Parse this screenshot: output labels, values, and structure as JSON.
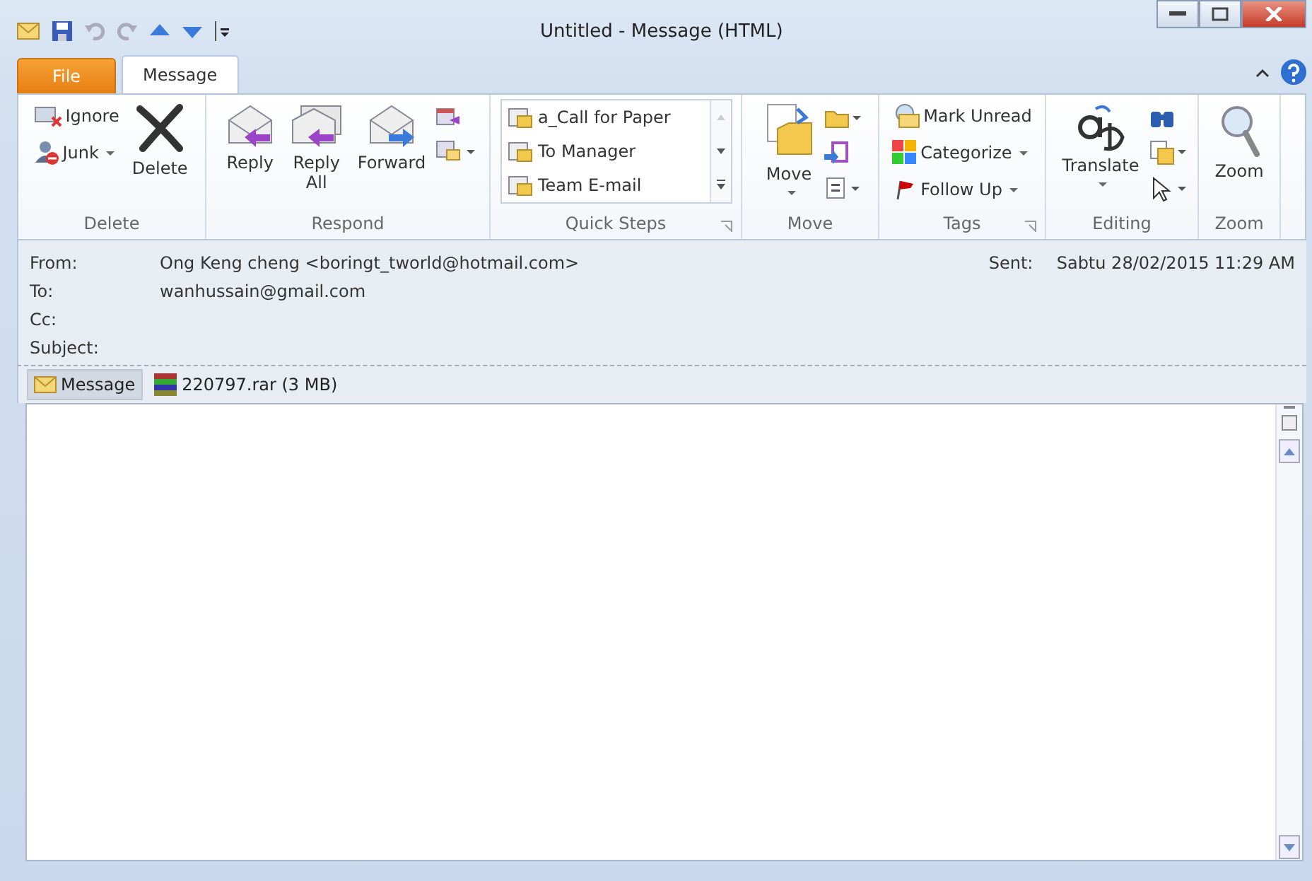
{
  "window": {
    "title": "Untitled  -  Message (HTML)"
  },
  "tabs": [
    {
      "label": "File",
      "kind": "file",
      "selected": false
    },
    {
      "label": "Message",
      "kind": "tab",
      "selected": true
    }
  ],
  "ribbon": {
    "delete": {
      "label": "Delete",
      "ignore": "Ignore",
      "junk": "Junk",
      "delete": "Delete"
    },
    "respond": {
      "label": "Respond",
      "reply": "Reply",
      "reply_all": [
        "Reply",
        "All"
      ],
      "forward": "Forward"
    },
    "quick_steps": {
      "label": "Quick Steps",
      "items": [
        "a_Call for Paper",
        "To Manager",
        "Team E-mail"
      ]
    },
    "move": {
      "label": "Move",
      "move": "Move"
    },
    "tags": {
      "label": "Tags",
      "items": [
        "Mark Unread",
        "Categorize",
        "Follow Up"
      ]
    },
    "editing": {
      "label": "Editing",
      "translate": "Translate"
    },
    "zoom": {
      "label": "Zoom",
      "zoom": "Zoom"
    }
  },
  "header": {
    "fields": [
      {
        "label": "From:",
        "value": "Ong Keng cheng <boringt_tworld@hotmail.com>"
      },
      {
        "label": "To:",
        "value": "wanhussain@gmail.com"
      },
      {
        "label": "Cc:"
      },
      {
        "label": "Subject:"
      }
    ],
    "sent": {
      "label": "Sent:",
      "value": "Sabtu 28/02/2015 11:29 AM"
    }
  },
  "attachments": [
    {
      "label": "Message",
      "kind": "message",
      "selected": true
    },
    {
      "label": "220797.rar (3 MB)",
      "kind": "file",
      "selected": false
    }
  ]
}
